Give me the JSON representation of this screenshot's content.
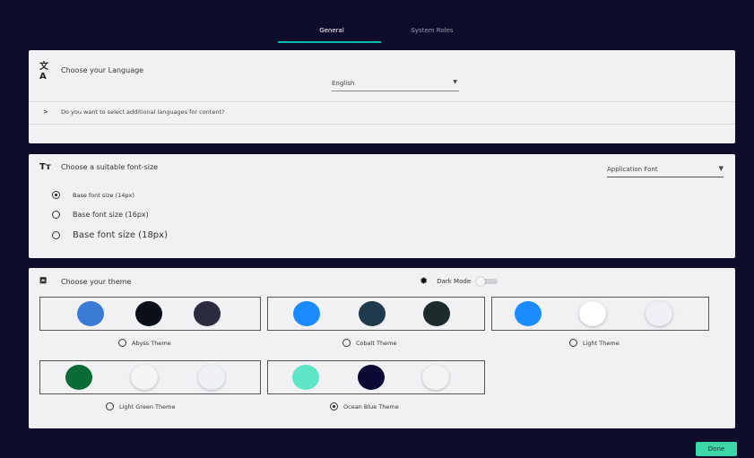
{
  "tabs": [
    {
      "label": "General",
      "active": true
    },
    {
      "label": "System Roles",
      "active": false
    }
  ],
  "language": {
    "heading": "Choose your Language",
    "selected": "English",
    "more_prompt": "Do you want to select additional languages for content?"
  },
  "font_size": {
    "heading": "Choose a suitable font-size",
    "font_select": "Application Font",
    "options": [
      {
        "label": "Base font size (14px)",
        "selected": true
      },
      {
        "label": "Base font size (16px)",
        "selected": false
      },
      {
        "label": "Base font size (18px)",
        "selected": false
      }
    ]
  },
  "theme": {
    "heading": "Choose your theme",
    "dark_mode_label": "Dark Mode",
    "dark_mode_on": false,
    "themes": [
      {
        "label": "Abyss Theme",
        "selected": false,
        "colors": [
          "#3a7bd5",
          "#0b0f1a",
          "#2b2b40"
        ]
      },
      {
        "label": "Cobalt Theme",
        "selected": false,
        "colors": [
          "#1a8cff",
          "#1f3a4d",
          "#1b2a2a"
        ]
      },
      {
        "label": "Light Theme",
        "selected": false,
        "colors": [
          "#1a8cff",
          "#ffffff",
          "#eef0f5"
        ]
      },
      {
        "label": "Light Green Theme",
        "selected": false,
        "colors": [
          "#0b6b34",
          "#f5f5f5",
          "#eef0f5"
        ]
      },
      {
        "label": "Ocean Blue Theme",
        "selected": true,
        "colors": [
          "#5ee6c6",
          "#0a0a35",
          "#f3f3f3"
        ]
      }
    ]
  },
  "footer": {
    "done_label": "Done"
  },
  "colors": {
    "background": "#0d0d2b",
    "accent": "#00b8b0",
    "done_button": "#3dd6a8"
  }
}
